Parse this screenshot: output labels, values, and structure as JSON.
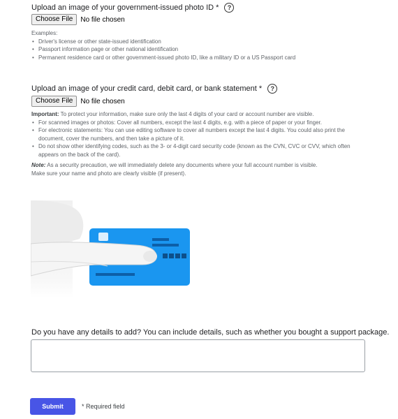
{
  "upload_id": {
    "label": "Upload an image of your government-issued photo ID *",
    "button": "Choose File",
    "status": "No file chosen",
    "examples_heading": "Examples:",
    "examples": [
      "Driver's license or other state-issued identification",
      "Passport information page or other national identification",
      "Permanent residence card or other government-issued photo ID, like a military ID or a US Passport card"
    ]
  },
  "upload_card": {
    "label": "Upload an image of your credit card, debit card, or bank statement *",
    "button": "Choose File",
    "status": "No file chosen",
    "important_bold": "Important:",
    "important_text": "To protect your information, make sure only the last 4 digits of your card or account number are visible.",
    "bullets": [
      "For scanned images or photos: Cover all numbers, except the last 4 digits, e.g. with a piece of paper or your finger.",
      "For electronic statements: You can use editing software to cover all numbers except the last 4 digits. You could also print the document, cover the numbers, and then take a picture of it.",
      "Do not show other identifying codes, such as the 3- or 4-digit card security code (known as the CVN, CVC or CVV, which often appears on the back of the card)."
    ],
    "note_label": "Note:",
    "note_text": "As a security precaution, we will immediately delete any documents where your full account number is visible.",
    "note_line2": "Make sure your name and photo are clearly visible (if present)."
  },
  "help_icon_glyph": "?",
  "illustration": {
    "icon": "hand-covering-card",
    "card_color": "#1a96f0"
  },
  "details": {
    "label": "Do you have any details to add? You can include details, such as whether you bought a support package.",
    "value": ""
  },
  "submit_label": "Submit",
  "required_note": "* Required field"
}
